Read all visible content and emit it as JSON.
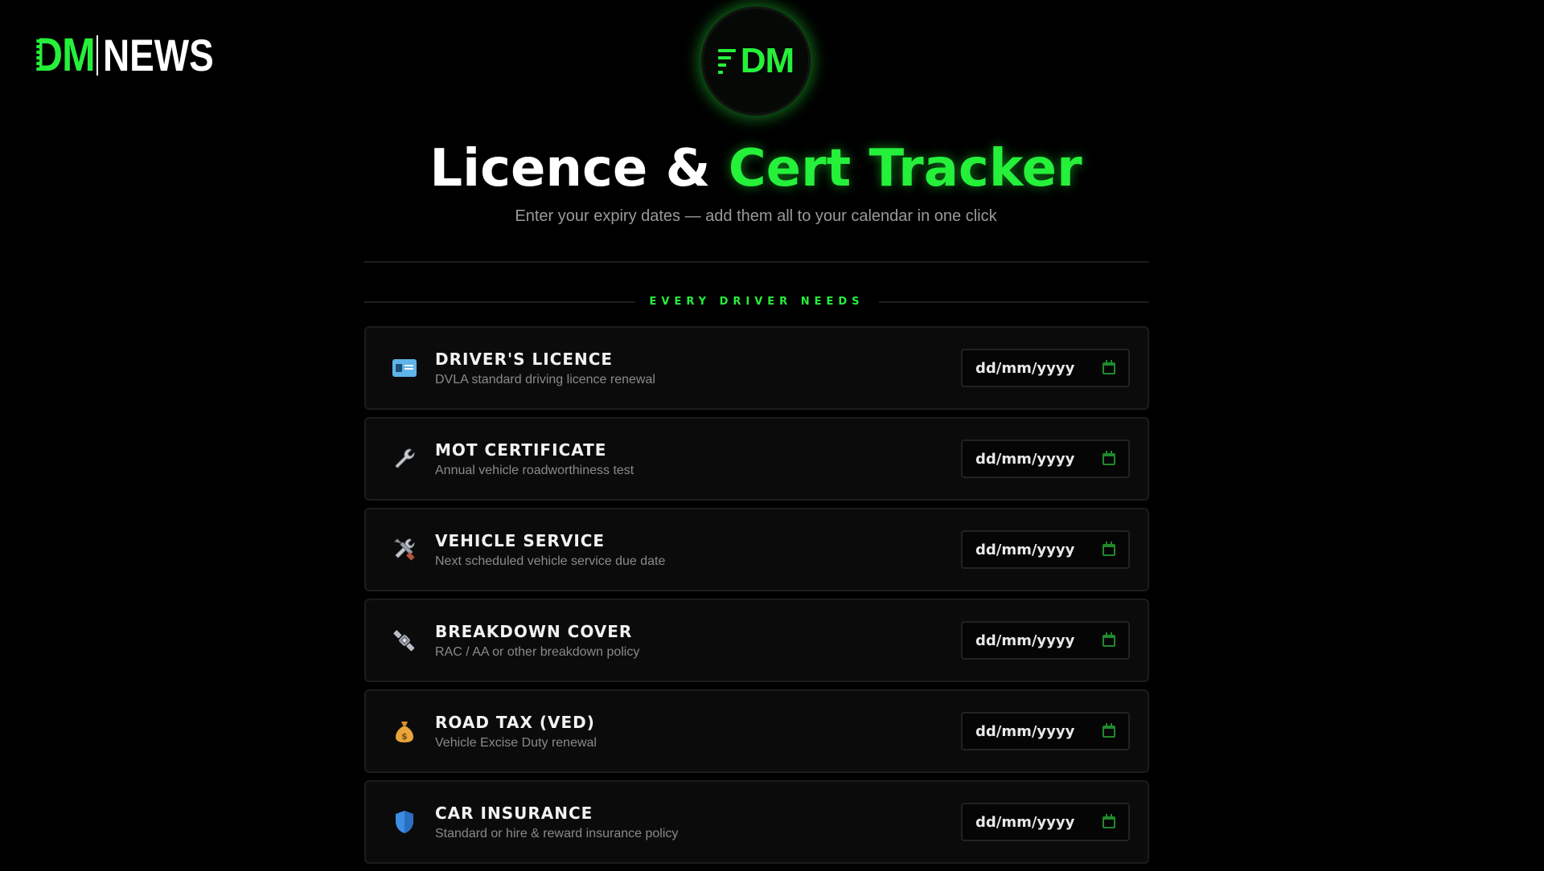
{
  "brand": {
    "dm": "DM",
    "news": "NEWS"
  },
  "logo": {
    "text": "DM"
  },
  "header": {
    "title_white": "Licence & ",
    "title_green": "Cert Tracker",
    "subtitle": "Enter your expiry dates — add them all to your calendar in one click"
  },
  "section": {
    "label": "EVERY DRIVER NEEDS"
  },
  "colors": {
    "accent": "#25f03a",
    "background": "#000000",
    "card": "#0b0b0b"
  },
  "items": [
    {
      "icon": "id-card-icon",
      "title": "DRIVER'S LICENCE",
      "desc": "DVLA standard driving licence renewal",
      "placeholder": "dd/mm/yyyy"
    },
    {
      "icon": "wrench-icon",
      "title": "MOT CERTIFICATE",
      "desc": "Annual vehicle roadworthiness test",
      "placeholder": "dd/mm/yyyy"
    },
    {
      "icon": "tools-icon",
      "title": "VEHICLE SERVICE",
      "desc": "Next scheduled vehicle service due date",
      "placeholder": "dd/mm/yyyy"
    },
    {
      "icon": "satellite-icon",
      "title": "BREAKDOWN COVER",
      "desc": "RAC / AA or other breakdown policy",
      "placeholder": "dd/mm/yyyy"
    },
    {
      "icon": "money-bag-icon",
      "title": "ROAD TAX (VED)",
      "desc": "Vehicle Excise Duty renewal",
      "placeholder": "dd/mm/yyyy"
    },
    {
      "icon": "shield-icon",
      "title": "CAR INSURANCE",
      "desc": "Standard or hire & reward insurance policy",
      "placeholder": "dd/mm/yyyy"
    }
  ]
}
